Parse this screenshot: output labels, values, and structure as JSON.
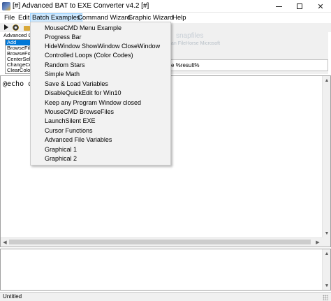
{
  "window": {
    "title": "[#] Advanced BAT to EXE Converter v4.2 [#]",
    "minimize_label": "—",
    "close_label": "✕"
  },
  "menu": {
    "file": "File",
    "edit": "Edit",
    "batch_examples": "Batch Examples",
    "command_wizard": "Command Wizard",
    "graphic_wizard": "Graphic Wizard",
    "help": "Help"
  },
  "batch_examples_menu": {
    "items": [
      "MouseCMD Menu Example",
      "Progress Bar",
      "HideWindow ShowWindow CloseWindow",
      "Controlled Loops (Color Codes)",
      "Random Stars",
      "Simple Math",
      "Save & Load Variables",
      "DisableQuickEdit for Win10",
      "Keep any Program Window closed",
      "MouseCMD BrowseFiles",
      "LaunchSilent EXE",
      "Cursor Functions",
      "Advanced File Variables",
      "Graphical 1",
      "Graphical 2"
    ]
  },
  "left_panel": {
    "label": "Advanced C",
    "list_items": [
      "Add",
      "BrowseFiles",
      "BrowseFolder",
      "CenterSelf",
      "ChangeColor",
      "ClearColor"
    ],
    "selected_index": 0
  },
  "background_panel": {
    "watermark_text": "snapfiles",
    "watermark_sub": "an FileHorse Microsoft",
    "field_text": "e %result%"
  },
  "editor": {
    "content": "@echo o"
  },
  "status_bar": {
    "text": "Untitled"
  },
  "icons": {
    "app": "app-icon",
    "run": "play-icon",
    "settings": "gear-icon",
    "open": "folder-icon"
  },
  "colors": {
    "menu_highlight": "#cce8ff",
    "selection": "#0078d7",
    "dropdown_bg": "#f2f2f2"
  }
}
